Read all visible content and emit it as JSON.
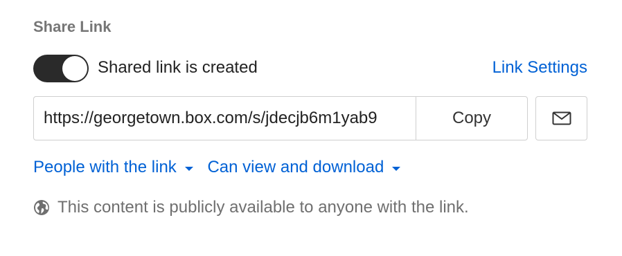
{
  "share": {
    "title": "Share Link",
    "toggle_label": "Shared link is created",
    "toggle_on": true,
    "link_settings": "Link Settings",
    "url": "https://georgetown.box.com/s/jdecjb6m1yab9",
    "copy_label": "Copy",
    "email_icon": "envelope-icon",
    "access_dropdown": "People with the link",
    "permission_dropdown": "Can view and download",
    "info_icon": "globe-icon",
    "info_text": "This content is publicly available to anyone with the link."
  },
  "colors": {
    "accent": "#0061d5",
    "toggle_on": "#2a2a2a",
    "muted_text": "#767676",
    "border": "#cfcfcf"
  }
}
